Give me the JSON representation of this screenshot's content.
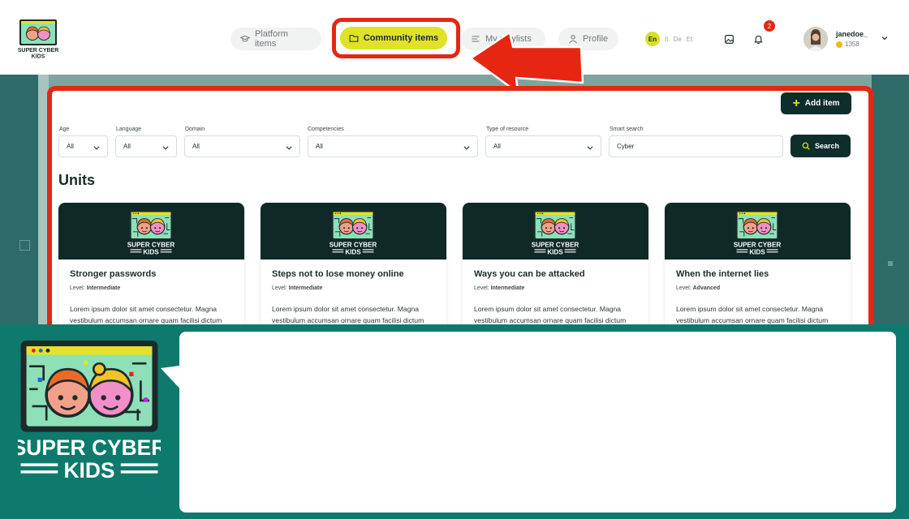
{
  "nav": {
    "platform_items": "Platform items",
    "community_items": "Community items",
    "my_playlists": "My playlists",
    "profile": "Profile"
  },
  "languages": {
    "active": "En",
    "others": [
      "It",
      "De",
      "Et"
    ]
  },
  "notifications": {
    "count": "2"
  },
  "user": {
    "name": "janedoe_",
    "points": "1358"
  },
  "toolbar": {
    "add_item": "Add item",
    "search_button": "Search"
  },
  "filters": [
    {
      "label": "Age",
      "value": "All"
    },
    {
      "label": "Language",
      "value": "All"
    },
    {
      "label": "Domain",
      "value": "All"
    },
    {
      "label": "Competencies",
      "value": "All"
    },
    {
      "label": "Type of resource",
      "value": "All"
    },
    {
      "label": "Smart search",
      "value": "Cyber"
    }
  ],
  "units_title": "Units",
  "cards": [
    {
      "title": "Stronger passwords",
      "level_label": "Level:",
      "level": "Intermediate",
      "desc": "Lorem ipsum dolor sit amet consectetur. Magna vestibulum accumsan ornare quam facilisi dictum"
    },
    {
      "title": "Steps not to lose money online",
      "level_label": "Level:",
      "level": "Intermediate",
      "desc": "Lorem ipsum dolor sit amet consectetur. Magna vestibulum accumsan ornare quam facilisi dictum"
    },
    {
      "title": "Ways you can be attacked",
      "level_label": "Level:",
      "level": "Intermediate",
      "desc": "Lorem ipsum dolor sit amet consectetur. Magna vestibulum accumsan ornare quam facilisi dictum"
    },
    {
      "title": "When the internet lies",
      "level_label": "Level:",
      "level": "Advanced",
      "desc": "Lorem ipsum dolor sit amet consectetur. Magna vestibulum accumsan ornare quam facilisi dictum"
    }
  ],
  "brand": {
    "line1": "SUPER CYBER",
    "line2": "KIDS"
  },
  "colors": {
    "accent": "#e1e12a",
    "highlight": "#e62612",
    "dark": "#0f2d2b",
    "teal": "#0d7a6d"
  },
  "icons": [
    "graduation-cap-icon",
    "folder-icon",
    "list-icon",
    "user-icon",
    "gallery-icon",
    "bell-icon",
    "chevron-down-icon",
    "plus-icon",
    "search-icon"
  ]
}
